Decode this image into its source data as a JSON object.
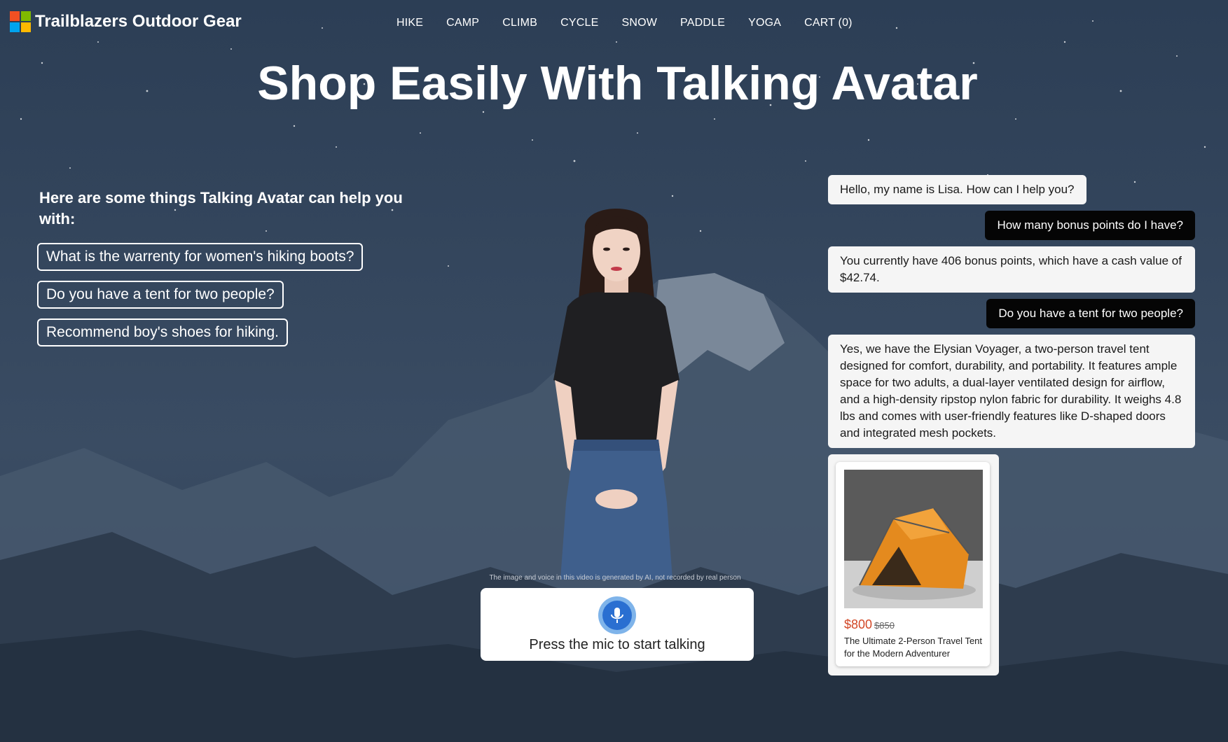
{
  "header": {
    "brand": "Trailblazers Outdoor Gear",
    "nav": [
      "HIKE",
      "CAMP",
      "CLIMB",
      "CYCLE",
      "SNOW",
      "PADDLE",
      "YOGA",
      "CART (0)"
    ]
  },
  "hero": {
    "title": "Shop Easily With Talking Avatar"
  },
  "help": {
    "heading": "Here are some things Talking Avatar can help you with:",
    "suggestions": [
      "What is the warrenty for women's hiking boots?",
      "Do you have a tent for two people?",
      "Recommend boy's shoes for hiking."
    ]
  },
  "avatar": {
    "disclaimer": "The image and voice in this video is generated by AI, not recorded by real person"
  },
  "mic": {
    "label": "Press the mic to start talking"
  },
  "chat": {
    "messages": [
      {
        "role": "bot",
        "text": "Hello, my name is Lisa. How can I help you?"
      },
      {
        "role": "user",
        "text": "How many bonus points do I have?"
      },
      {
        "role": "bot",
        "text": "You currently have 406 bonus points, which have a cash value of $42.74."
      },
      {
        "role": "user",
        "text": "Do you have a tent for two people?"
      },
      {
        "role": "bot",
        "text": "Yes, we have the Elysian Voyager, a two-person travel tent designed for comfort, durability, and portability. It features ample space for two adults, a dual-layer ventilated design for airflow, and a high-density ripstop nylon fabric for durability. It weighs 4.8 lbs and comes with user-friendly features like D-shaped doors and integrated mesh pockets."
      }
    ],
    "product": {
      "price": "$800",
      "old_price": "$850",
      "name": "The Ultimate 2-Person Travel Tent for the Modern Adventurer"
    }
  },
  "colors": {
    "brand_red": "#f25022",
    "brand_green": "#7fba00",
    "brand_blue": "#00a4ef",
    "brand_yellow": "#ffb900",
    "price_accent": "#d24726",
    "mic_blue": "#2a6fd1"
  }
}
